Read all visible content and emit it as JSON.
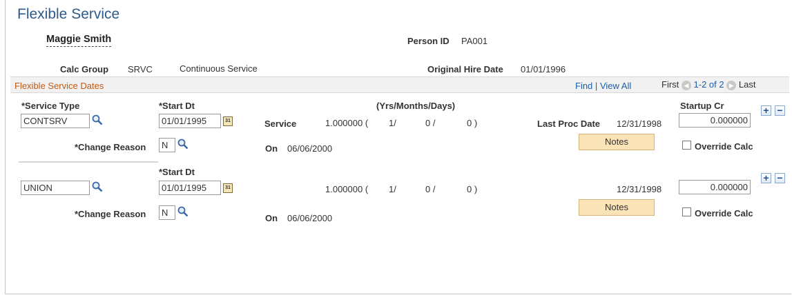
{
  "page": {
    "title": "Flexible Service"
  },
  "person": {
    "name": "Maggie Smith",
    "person_id_label": "Person ID",
    "person_id": "PA001",
    "calc_group_label": "Calc Group",
    "calc_group": "SRVC",
    "calc_group_desc": "Continuous Service",
    "orig_hire_label": "Original Hire Date",
    "orig_hire": "01/01/1996"
  },
  "grid": {
    "title": "Flexible Service Dates",
    "find": "Find",
    "sep": "|",
    "view_all": "View All",
    "first": "First",
    "range": "1-2 of 2",
    "last": "Last"
  },
  "labels": {
    "service_type": "*Service Type",
    "start_dt": "*Start Dt",
    "yrs_months_days": "(Yrs/Months/Days)",
    "startup_cr": "Startup Cr",
    "service": "Service",
    "last_proc_date": "Last Proc Date",
    "change_reason": "*Change Reason",
    "on": "On",
    "notes": "Notes",
    "override_calc": "Override Calc"
  },
  "rows": [
    {
      "service_type": "CONTSRV",
      "start_dt": "01/01/1995",
      "service_value": "1.000000 (",
      "years": "1/",
      "months": "0 /",
      "days": "0 )",
      "last_proc_date": "12/31/1998",
      "startup_cr": "0.000000",
      "change_reason": "N",
      "on_date": "06/06/2000",
      "override_calc": false
    },
    {
      "service_type": "UNION",
      "start_dt": "01/01/1995",
      "service_value": "1.000000 (",
      "years": "1/",
      "months": "0 /",
      "days": "0 )",
      "last_proc_date": "12/31/1998",
      "startup_cr": "0.000000",
      "change_reason": "N",
      "on_date": "06/06/2000",
      "override_calc": false
    }
  ],
  "icons": {
    "lookup": "magnifier-icon",
    "calendar": "calendar-icon",
    "calendar_text": "31",
    "add": "+",
    "delete": "−",
    "prev": "◀",
    "next": "▶"
  }
}
